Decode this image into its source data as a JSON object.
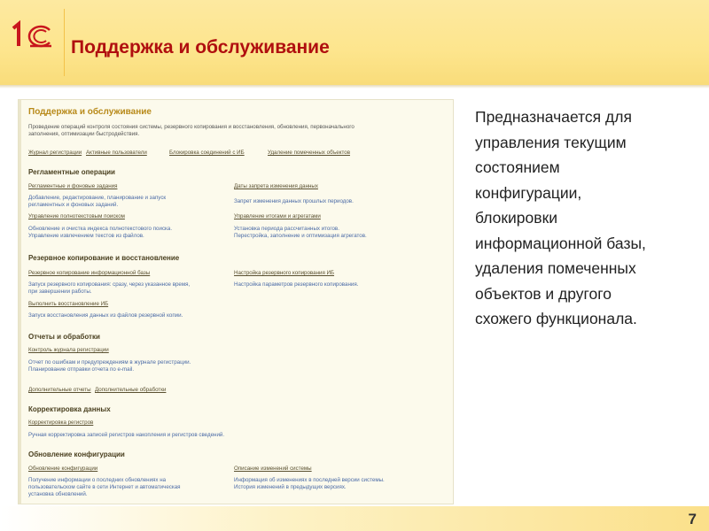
{
  "slide": {
    "title": "Поддержка и обслуживание",
    "page_number": "7",
    "logo_text": "1С"
  },
  "panel": {
    "title": "Поддержка и обслуживание",
    "description": [
      "Проведение операций контроля состояния системы, резервного копирования и восстановления, обновления, первоначального",
      "заполнения, оптимизации быстродействия."
    ],
    "top_links": [
      "Журнал регистрации",
      "Активные пользователи",
      "Блокировка соединений с ИБ",
      "Удаление помеченных объектов"
    ],
    "sections": {
      "routine": {
        "title": "Регламентные операции",
        "l1": "Регламентные и фоновые задания",
        "d1": [
          "Добавление, редактирование, планирование и запуск",
          "регламентных и фоновых заданий."
        ],
        "r1": "Даты запрета изменения данных",
        "rd1": "Запрет изменения данных прошлых периодов.",
        "l2": "Управление полнотекстовым поиском",
        "d2": [
          "Обновление и очистка индекса полнотекстового поиска.",
          "Управление извлечением текстов из файлов."
        ],
        "r2": "Управление итогами и агрегатами",
        "rd2": [
          "Установка периода рассчитанных итогов.",
          "Перестройка, заполнение и оптимизация агрегатов."
        ]
      },
      "backup": {
        "title": "Резервное копирование и восстановление",
        "l1": "Резервное копирование информационной базы",
        "d1": [
          "Запуск резервного копирования: сразу, через указанное время,",
          "при завершении работы."
        ],
        "r1": "Настройка резервного копирования ИБ",
        "rd1": "Настройка параметров резервного копирования.",
        "l2": "Выполнить восстановление ИБ",
        "d2": "Запуск восстановления данных из файлов резервной копии."
      },
      "reports": {
        "title": "Отчеты и обработки",
        "l1": "Контроль журнала регистрации",
        "d1": [
          "Отчет по ошибкам и предупреждениям в журнале регистрации.",
          "Планирование отправки отчета по e-mail."
        ],
        "l2": "Дополнительные отчеты",
        "l3": "Дополнительные обработки"
      },
      "correction": {
        "title": "Корректировка данных",
        "l1": "Корректировка регистров",
        "d1": "Ручная корректировка записей регистров накопления и регистров сведений."
      },
      "update": {
        "title": "Обновление конфигурации",
        "l1": "Обновление конфигурации",
        "d1": [
          "Получение информации о последних обновлениях на",
          "пользовательском сайте в сети Интернет и автоматическая",
          "установка обновлений."
        ],
        "r1": "Описание изменений системы",
        "rd1": [
          "Информация об изменениях в последней версии системы.",
          "История изменений в предыдущих версиях."
        ]
      }
    }
  },
  "description_lines": [
    "Предназначается для",
    "управления текущим",
    "состоянием",
    "конфигурации,",
    "блокировки",
    "информационной базы,",
    "удаления помеченных",
    "объектов и другого",
    "схожего функционала."
  ]
}
